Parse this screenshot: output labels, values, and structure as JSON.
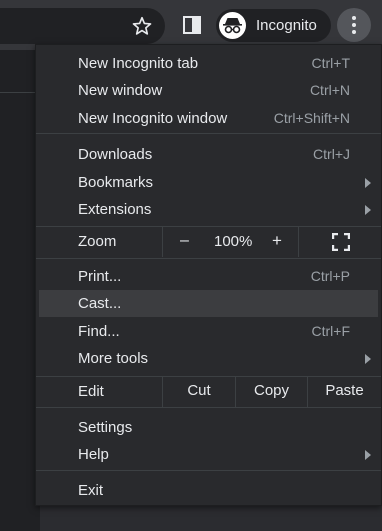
{
  "toolbar": {
    "incognito_label": "Incognito"
  },
  "menu": {
    "new_tab": {
      "label": "New Incognito tab",
      "shortcut": "Ctrl+T"
    },
    "new_window": {
      "label": "New window",
      "shortcut": "Ctrl+N"
    },
    "new_incognito_window": {
      "label": "New Incognito window",
      "shortcut": "Ctrl+Shift+N"
    },
    "downloads": {
      "label": "Downloads",
      "shortcut": "Ctrl+J"
    },
    "bookmarks": {
      "label": "Bookmarks"
    },
    "extensions": {
      "label": "Extensions"
    },
    "zoom": {
      "label": "Zoom",
      "minus": "–",
      "value": "100%",
      "plus": "+"
    },
    "print": {
      "label": "Print...",
      "shortcut": "Ctrl+P"
    },
    "cast": {
      "label": "Cast..."
    },
    "find": {
      "label": "Find...",
      "shortcut": "Ctrl+F"
    },
    "more_tools": {
      "label": "More tools"
    },
    "edit": {
      "label": "Edit",
      "cut": "Cut",
      "copy": "Copy",
      "paste": "Paste"
    },
    "settings": {
      "label": "Settings"
    },
    "help": {
      "label": "Help"
    },
    "exit": {
      "label": "Exit"
    }
  },
  "colors": {
    "menu_bg": "#292a2d",
    "highlight": "#3c3d40",
    "text": "#e8eaed",
    "shortcut_text": "#9aa0a6"
  }
}
